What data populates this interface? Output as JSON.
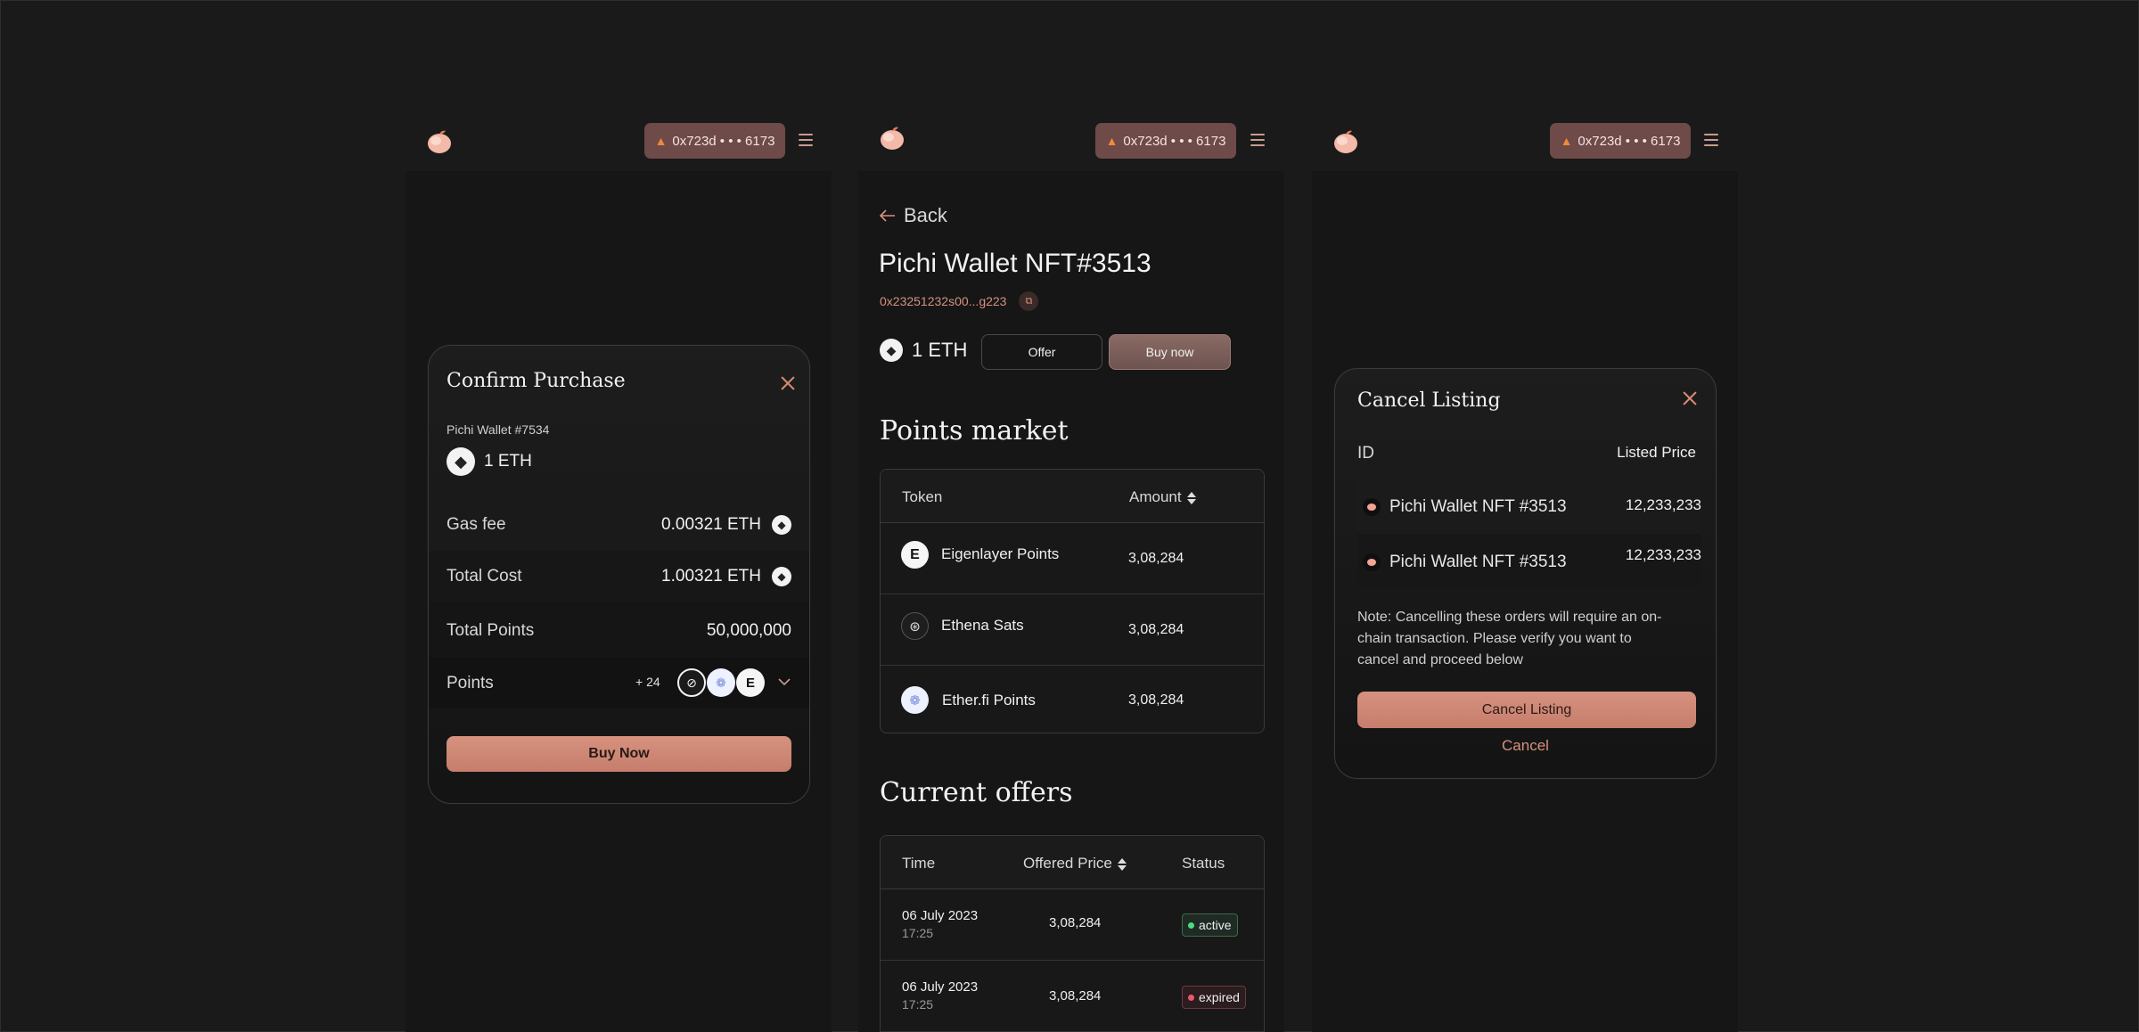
{
  "wallet": {
    "address": "0x723d • • • 6173"
  },
  "confirm": {
    "title": "Confirm Purchase",
    "item_name": "Pichi Wallet #7534",
    "price": "1 ETH",
    "rows": [
      {
        "label": "Gas fee",
        "value": "0.00321 ETH"
      },
      {
        "label": "Total Cost",
        "value": "1.00321 ETH"
      },
      {
        "label": "Total Points",
        "value": "50,000,000"
      }
    ],
    "points_label": "Points",
    "points_more": "+ 24",
    "buy_label": "Buy Now"
  },
  "detail": {
    "back_label": "Back",
    "title": "Pichi Wallet NFT#3513",
    "address": "0x23251232s00...g223",
    "price": "1 ETH",
    "offer_label": "Offer",
    "buy_label": "Buy now",
    "points_market": {
      "heading": "Points market",
      "col_token": "Token",
      "col_amount": "Amount",
      "rows": [
        {
          "token": "Eigenlayer Points",
          "amount": "3,08,284"
        },
        {
          "token": "Ethena Sats",
          "amount": "3,08,284"
        },
        {
          "token": "Ether.fi Points",
          "amount": "3,08,284"
        }
      ]
    },
    "offers": {
      "heading": "Current offers",
      "col_time": "Time",
      "col_price": "Offered Price",
      "col_status": "Status",
      "rows": [
        {
          "date": "06 July 2023",
          "time": "17:25",
          "price": "3,08,284",
          "status": "active"
        },
        {
          "date": "06 July 2023",
          "time": "17:25",
          "price": "3,08,284",
          "status": "expired"
        }
      ]
    }
  },
  "cancel": {
    "title": "Cancel Listing",
    "col_id": "ID",
    "col_price": "Listed Price",
    "rows": [
      {
        "name": "Pichi Wallet NFT #3513",
        "price": "12,233,233"
      },
      {
        "name": "Pichi Wallet NFT #3513",
        "price": "12,233,233"
      }
    ],
    "note": "Note: Cancelling these orders will require an on-chain transaction. Please verify you want to cancel and proceed below",
    "confirm_label": "Cancel Listing",
    "cancel_label": "Cancel"
  },
  "colors": {
    "accent": "#d6917f",
    "pill": "#6e4a48",
    "active": "#4ade80",
    "expired": "#f0556b"
  }
}
